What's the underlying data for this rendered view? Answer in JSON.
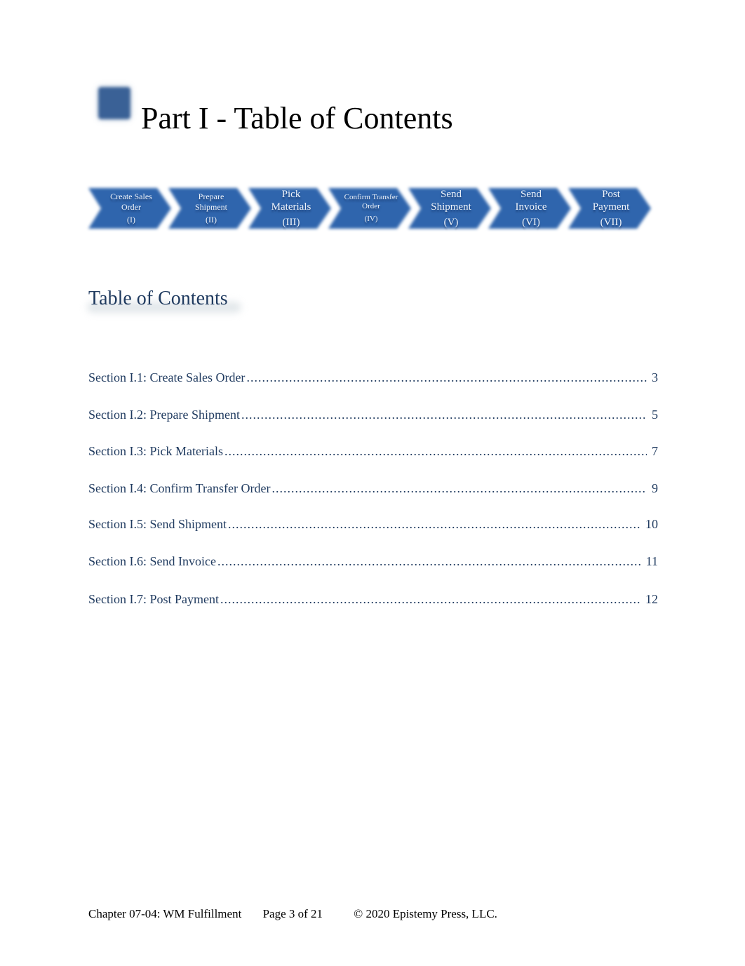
{
  "header": {
    "title": "Part I - Table of Contents",
    "icon": "blue-square-icon"
  },
  "colors": {
    "accent": "#3a6196",
    "step_fill": "#2f65ad",
    "toc_text": "#1f3a5f"
  },
  "process_steps": [
    {
      "name": "Create Sales Order",
      "numeral": "(I)"
    },
    {
      "name": "Prepare Shipment",
      "numeral": "(II)"
    },
    {
      "name": "Pick Materials",
      "numeral": "(III)"
    },
    {
      "name": "Confirm Transfer Order",
      "numeral": "(IV)"
    },
    {
      "name": "Send Shipment",
      "numeral": "(V)"
    },
    {
      "name": "Send Invoice",
      "numeral": "(VI)"
    },
    {
      "name": "Post Payment",
      "numeral": "(VII)"
    }
  ],
  "toc": {
    "heading": "Table of Contents",
    "entries": [
      {
        "label": "Section I.1: Create Sales Order",
        "page": "3"
      },
      {
        "label": "Section I.2: Prepare Shipment",
        "page": "5"
      },
      {
        "label": "Section I.3: Pick Materials",
        "page": "7"
      },
      {
        "label": "Section I.4: Confirm Transfer Order",
        "page": "9"
      },
      {
        "label": "Section I.5: Send Shipment",
        "page": "10"
      },
      {
        "label": "Section I.6: Send Invoice",
        "page": "11"
      },
      {
        "label": "Section I.7: Post Payment",
        "page": "12"
      }
    ]
  },
  "footer": {
    "chapter": "Chapter 07-04: WM Fulfillment",
    "page": "Page 3 of 21",
    "copyright": "© 2020 Epistemy Press, LLC."
  }
}
